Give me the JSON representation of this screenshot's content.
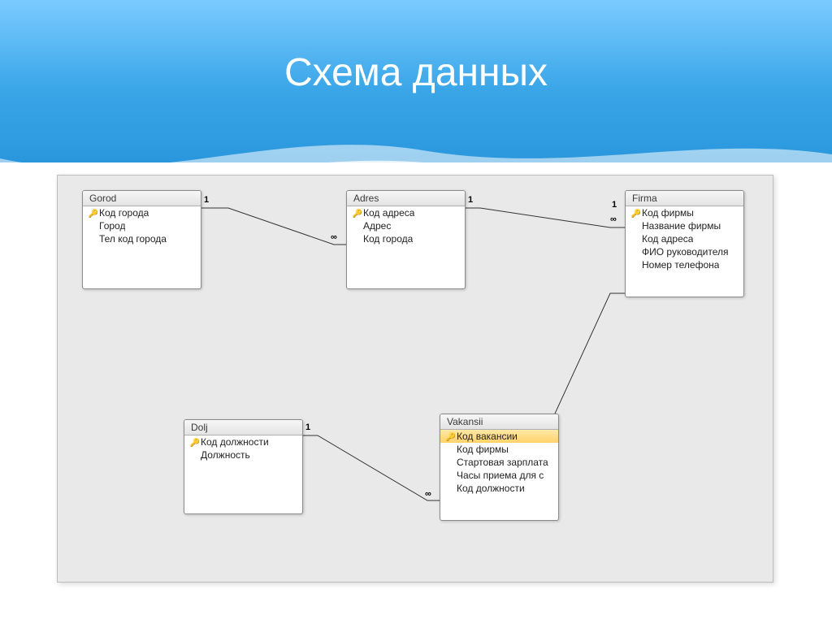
{
  "title": "Схема данных",
  "card": {
    "one": "1",
    "many": "∞"
  },
  "tables": {
    "gorod": {
      "name": "Gorod",
      "fields": [
        {
          "label": "Код города",
          "pk": true
        },
        {
          "label": "Город",
          "pk": false
        },
        {
          "label": "Тел код города",
          "pk": false
        }
      ]
    },
    "adres": {
      "name": "Adres",
      "fields": [
        {
          "label": "Код адреса",
          "pk": true
        },
        {
          "label": "Адрес",
          "pk": false
        },
        {
          "label": "Код города",
          "pk": false
        }
      ]
    },
    "firma": {
      "name": "Firma",
      "fields": [
        {
          "label": "Код фирмы",
          "pk": true
        },
        {
          "label": "Название фирмы",
          "pk": false
        },
        {
          "label": "Код адреса",
          "pk": false
        },
        {
          "label": "ФИО руководителя",
          "pk": false
        },
        {
          "label": "Номер телефона",
          "pk": false
        }
      ]
    },
    "dolj": {
      "name": "Dolj",
      "fields": [
        {
          "label": "Код должности",
          "pk": true
        },
        {
          "label": "Должность",
          "pk": false
        }
      ]
    },
    "vakansii": {
      "name": "Vakansii",
      "fields": [
        {
          "label": "Код вакансии",
          "pk": true,
          "selected": true
        },
        {
          "label": "Код фирмы",
          "pk": false
        },
        {
          "label": "Стартовая зарплата",
          "pk": false
        },
        {
          "label": "Часы приема для с",
          "pk": false
        },
        {
          "label": "Код должности",
          "pk": false
        }
      ]
    }
  },
  "relations": [
    {
      "from": "gorod",
      "to": "adres",
      "type": "one-to-many"
    },
    {
      "from": "adres",
      "to": "firma",
      "type": "one-to-many"
    },
    {
      "from": "firma",
      "to": "vakansii",
      "type": "one-to-many"
    },
    {
      "from": "dolj",
      "to": "vakansii",
      "type": "one-to-many"
    }
  ]
}
